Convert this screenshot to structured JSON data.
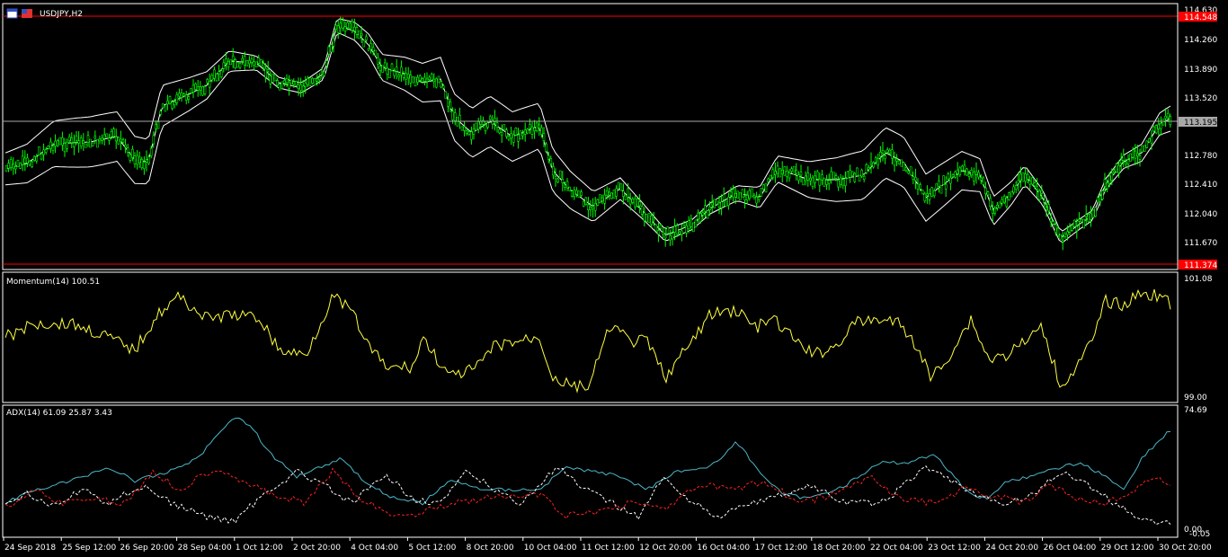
{
  "colors": {
    "background": "#000000",
    "frame": "#ffffff",
    "candle": "#00ff00",
    "bands": "#ffffff",
    "level_line": "#ff0000",
    "price_line": "#a8a8a8",
    "momentum": "#ffff40",
    "adx_main": "#4ab8c8",
    "adx_plus": "#ffffff",
    "adx_minus": "#ff2020"
  },
  "main": {
    "symbol_label": "USDJPY,H2",
    "high_level": "114.548",
    "low_level": "111.374",
    "current_price": "113.195",
    "y_ticks": [
      "114.630",
      "114.260",
      "113.890",
      "113.520",
      "112.780",
      "112.410",
      "112.040",
      "111.670"
    ]
  },
  "momentum": {
    "label": "Momentum(14) 100.51",
    "top_tick": "101.08",
    "bottom_tick": "99.00"
  },
  "adx": {
    "label": "ADX(14) 61.09 25.87 3.43",
    "top_tick": "74.69",
    "bottom_tick": "0.00",
    "bottom_tick_extra": "-0.05"
  },
  "time_axis": [
    "24 Sep 2018",
    "25 Sep 12:00",
    "26 Sep 20:00",
    "28 Sep 04:00",
    "1 Oct 12:00",
    "2 Oct 20:00",
    "4 Oct 04:00",
    "5 Oct 12:00",
    "8 Oct 20:00",
    "10 Oct 04:00",
    "11 Oct 12:00",
    "12 Oct 20:00",
    "16 Oct 04:00",
    "17 Oct 12:00",
    "18 Oct 20:00",
    "22 Oct 04:00",
    "23 Oct 12:00",
    "24 Oct 20:00",
    "26 Oct 04:00",
    "29 Oct 12:00",
    "30 Oct 20:00"
  ]
}
